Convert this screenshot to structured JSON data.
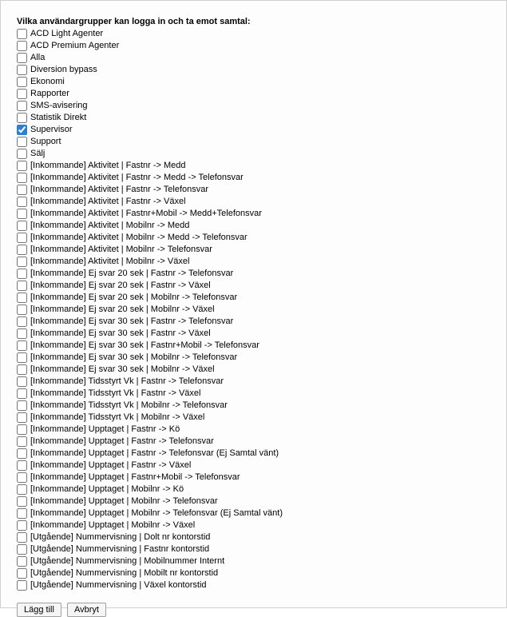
{
  "heading": "Vilka användargrupper kan logga in och ta emot samtal:",
  "groups": [
    {
      "label": "ACD Light Agenter",
      "checked": false
    },
    {
      "label": "ACD Premium Agenter",
      "checked": false
    },
    {
      "label": "Alla",
      "checked": false
    },
    {
      "label": "Diversion bypass",
      "checked": false
    },
    {
      "label": "Ekonomi",
      "checked": false
    },
    {
      "label": "Rapporter",
      "checked": false
    },
    {
      "label": "SMS-avisering",
      "checked": false
    },
    {
      "label": "Statistik Direkt",
      "checked": false
    },
    {
      "label": "Supervisor",
      "checked": true
    },
    {
      "label": "Support",
      "checked": false
    },
    {
      "label": "Sälj",
      "checked": false
    },
    {
      "label": "[Inkommande] Aktivitet | Fastnr -> Medd",
      "checked": false
    },
    {
      "label": "[Inkommande] Aktivitet | Fastnr -> Medd -> Telefonsvar",
      "checked": false
    },
    {
      "label": "[Inkommande] Aktivitet | Fastnr -> Telefonsvar",
      "checked": false
    },
    {
      "label": "[Inkommande] Aktivitet | Fastnr -> Växel",
      "checked": false
    },
    {
      "label": "[Inkommande] Aktivitet | Fastnr+Mobil -> Medd+Telefonsvar",
      "checked": false
    },
    {
      "label": "[Inkommande] Aktivitet | Mobilnr -> Medd",
      "checked": false
    },
    {
      "label": "[Inkommande] Aktivitet | Mobilnr -> Medd -> Telefonsvar",
      "checked": false
    },
    {
      "label": "[Inkommande] Aktivitet | Mobilnr -> Telefonsvar",
      "checked": false
    },
    {
      "label": "[Inkommande] Aktivitet | Mobilnr -> Växel",
      "checked": false
    },
    {
      "label": "[Inkommande] Ej svar 20 sek | Fastnr -> Telefonsvar",
      "checked": false
    },
    {
      "label": "[Inkommande] Ej svar 20 sek | Fastnr -> Växel",
      "checked": false
    },
    {
      "label": "[Inkommande] Ej svar 20 sek | Mobilnr -> Telefonsvar",
      "checked": false
    },
    {
      "label": "[Inkommande] Ej svar 20 sek | Mobilnr -> Växel",
      "checked": false
    },
    {
      "label": "[Inkommande] Ej svar 30 sek | Fastnr -> Telefonsvar",
      "checked": false
    },
    {
      "label": "[Inkommande] Ej svar 30 sek | Fastnr -> Växel",
      "checked": false
    },
    {
      "label": "[Inkommande] Ej svar 30 sek | Fastnr+Mobil -> Telefonsvar",
      "checked": false
    },
    {
      "label": "[Inkommande] Ej svar 30 sek | Mobilnr -> Telefonsvar",
      "checked": false
    },
    {
      "label": "[Inkommande] Ej svar 30 sek | Mobilnr -> Växel",
      "checked": false
    },
    {
      "label": "[Inkommande] Tidsstyrt Vk | Fastnr -> Telefonsvar",
      "checked": false
    },
    {
      "label": "[Inkommande] Tidsstyrt Vk | Fastnr -> Växel",
      "checked": false
    },
    {
      "label": "[Inkommande] Tidsstyrt Vk | Mobilnr -> Telefonsvar",
      "checked": false
    },
    {
      "label": "[Inkommande] Tidsstyrt Vk | Mobilnr -> Växel",
      "checked": false
    },
    {
      "label": "[Inkommande] Upptaget | Fastnr -> Kö",
      "checked": false
    },
    {
      "label": "[Inkommande] Upptaget | Fastnr -> Telefonsvar",
      "checked": false
    },
    {
      "label": "[Inkommande] Upptaget | Fastnr -> Telefonsvar (Ej Samtal vänt)",
      "checked": false
    },
    {
      "label": "[Inkommande] Upptaget | Fastnr -> Växel",
      "checked": false
    },
    {
      "label": "[Inkommande] Upptaget | Fastnr+Mobil -> Telefonsvar",
      "checked": false
    },
    {
      "label": "[Inkommande] Upptaget | Mobilnr -> Kö",
      "checked": false
    },
    {
      "label": "[Inkommande] Upptaget | Mobilnr -> Telefonsvar",
      "checked": false
    },
    {
      "label": "[Inkommande] Upptaget | Mobilnr -> Telefonsvar (Ej Samtal vänt)",
      "checked": false
    },
    {
      "label": "[Inkommande] Upptaget | Mobilnr -> Växel",
      "checked": false
    },
    {
      "label": "[Utgående] Nummervisning | Dolt nr kontorstid",
      "checked": false
    },
    {
      "label": "[Utgående] Nummervisning | Fastnr kontorstid",
      "checked": false
    },
    {
      "label": "[Utgående] Nummervisning | Mobilnummer Internt",
      "checked": false
    },
    {
      "label": "[Utgående] Nummervisning | Mobilt nr kontorstid",
      "checked": false
    },
    {
      "label": "[Utgående] Nummervisning | Växel kontorstid",
      "checked": false
    }
  ],
  "buttons": {
    "add": "Lägg till",
    "cancel": "Avbryt"
  }
}
